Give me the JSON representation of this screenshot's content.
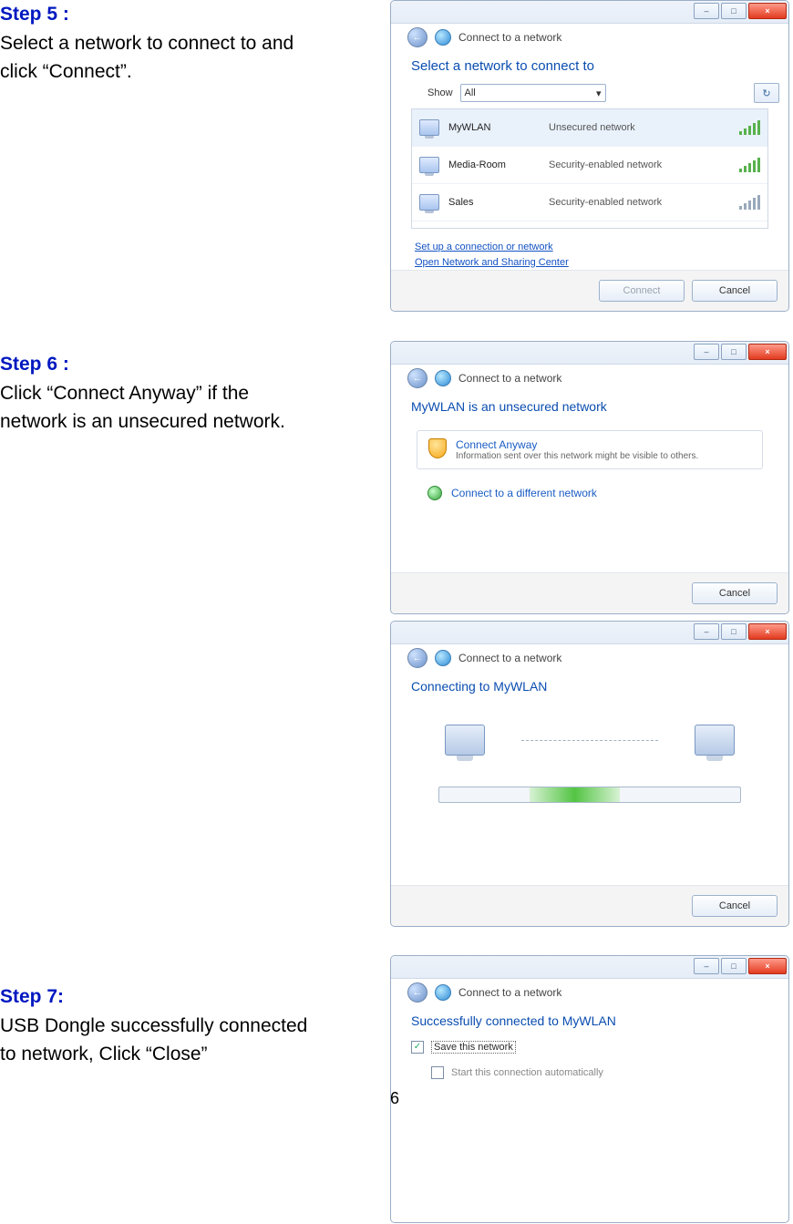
{
  "steps": {
    "s5": {
      "title": "Step 5 :",
      "body1": "Select a network to connect to and",
      "body2": "click “Connect”."
    },
    "s6": {
      "title": "Step 6 :",
      "body1": "Click “Connect Anyway” if the",
      "body2": "network is an unsecured network."
    },
    "s7": {
      "title": "Step 7:",
      "body1": "USB Dongle successfully connected",
      "body2": "to network, Click “Close”"
    }
  },
  "win_common": {
    "title": "Connect to a network",
    "min": "–",
    "max": "□",
    "close": "×"
  },
  "win1": {
    "heading": "Select a network to connect to",
    "show_label": "Show",
    "show_value": "All",
    "refresh": "↻",
    "networks": [
      {
        "name": "MyWLAN",
        "status": "Unsecured network",
        "secure": false
      },
      {
        "name": "Media-Room",
        "status": "Security-enabled network",
        "secure": true
      },
      {
        "name": "Sales",
        "status": "Security-enabled network",
        "secure": true
      }
    ],
    "link_setup": "Set up a connection or network",
    "link_center": "Open Network and Sharing Center",
    "btn_connect": "Connect",
    "btn_cancel": "Cancel"
  },
  "win2": {
    "heading": "MyWLAN is an unsecured network",
    "opt_title": "Connect Anyway",
    "opt_sub": "Information sent over this network might be visible to others.",
    "opt_diff": "Connect to a different network",
    "btn_cancel": "Cancel"
  },
  "win3": {
    "heading": "Connecting to MyWLAN",
    "btn_cancel": "Cancel"
  },
  "win4": {
    "heading": "Successfully connected to MyWLAN",
    "save_label": "Save this network",
    "start_label": "Start this connection automatically"
  },
  "page_no": "6"
}
